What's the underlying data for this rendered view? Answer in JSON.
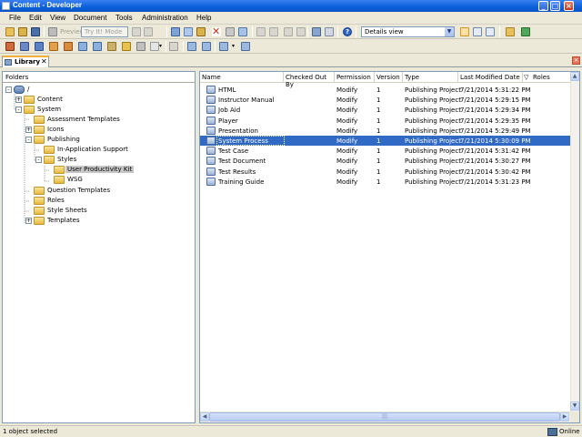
{
  "window": {
    "title": "Content - Developer"
  },
  "menu": [
    "File",
    "Edit",
    "View",
    "Document",
    "Tools",
    "Administration",
    "Help"
  ],
  "toolbar": {
    "preview_label": "Preview",
    "mode_combo": "Try It! Mode",
    "view_combo": "Details view"
  },
  "tabs": [
    {
      "label": "Library",
      "close": "✕"
    }
  ],
  "folders_pane": {
    "header": "Folders",
    "tree": [
      {
        "label": "/",
        "exp": "-"
      },
      {
        "label": "Content",
        "exp": "+"
      },
      {
        "label": "System",
        "exp": "-"
      },
      {
        "label": "Assessment Templates",
        "exp": ""
      },
      {
        "label": "Icons",
        "exp": "+"
      },
      {
        "label": "Publishing",
        "exp": "-"
      },
      {
        "label": "In-Application Support",
        "exp": ""
      },
      {
        "label": "Styles",
        "exp": "-"
      },
      {
        "label": "User Productivity Kit",
        "exp": ""
      },
      {
        "label": "WSG",
        "exp": ""
      },
      {
        "label": "Question Templates",
        "exp": ""
      },
      {
        "label": "Roles",
        "exp": ""
      },
      {
        "label": "Style Sheets",
        "exp": ""
      },
      {
        "label": "Templates",
        "exp": "+"
      }
    ]
  },
  "list": {
    "columns": [
      "Name",
      "Checked Out By",
      "Permission",
      "Version",
      "Type",
      "Last Modified Date",
      "Roles"
    ],
    "sort_indicator": "▽",
    "rows": [
      {
        "name": "HTML",
        "checked_out_by": "",
        "permission": "Modify",
        "version": "1",
        "type": "Publishing Project",
        "modified": "7/21/2014 5:31:22 PM"
      },
      {
        "name": "Instructor Manual",
        "checked_out_by": "",
        "permission": "Modify",
        "version": "1",
        "type": "Publishing Project",
        "modified": "7/21/2014 5:29:15 PM"
      },
      {
        "name": "Job Aid",
        "checked_out_by": "",
        "permission": "Modify",
        "version": "1",
        "type": "Publishing Project",
        "modified": "7/21/2014 5:29:34 PM"
      },
      {
        "name": "Player",
        "checked_out_by": "",
        "permission": "Modify",
        "version": "1",
        "type": "Publishing Project",
        "modified": "7/21/2014 5:29:35 PM"
      },
      {
        "name": "Presentation",
        "checked_out_by": "",
        "permission": "Modify",
        "version": "1",
        "type": "Publishing Project",
        "modified": "7/21/2014 5:29:49 PM"
      },
      {
        "name": "System Process",
        "checked_out_by": "",
        "permission": "Modify",
        "version": "1",
        "type": "Publishing Project",
        "modified": "7/21/2014 5:30:09 PM"
      },
      {
        "name": "Test Case",
        "checked_out_by": "",
        "permission": "Modify",
        "version": "1",
        "type": "Publishing Project",
        "modified": "7/21/2014 5:31:42 PM"
      },
      {
        "name": "Test Document",
        "checked_out_by": "",
        "permission": "Modify",
        "version": "1",
        "type": "Publishing Project",
        "modified": "7/21/2014 5:30:27 PM"
      },
      {
        "name": "Test Results",
        "checked_out_by": "",
        "permission": "Modify",
        "version": "1",
        "type": "Publishing Project",
        "modified": "7/21/2014 5:30:42 PM"
      },
      {
        "name": "Training Guide",
        "checked_out_by": "",
        "permission": "Modify",
        "version": "1",
        "type": "Publishing Project",
        "modified": "7/21/2014 5:31:23 PM"
      }
    ],
    "selected_row": "System Process"
  },
  "status": {
    "text": "1 object selected",
    "connection": "Online"
  },
  "colors": {
    "selection": "#316ac5",
    "titlebar": "#0a5fd8"
  }
}
